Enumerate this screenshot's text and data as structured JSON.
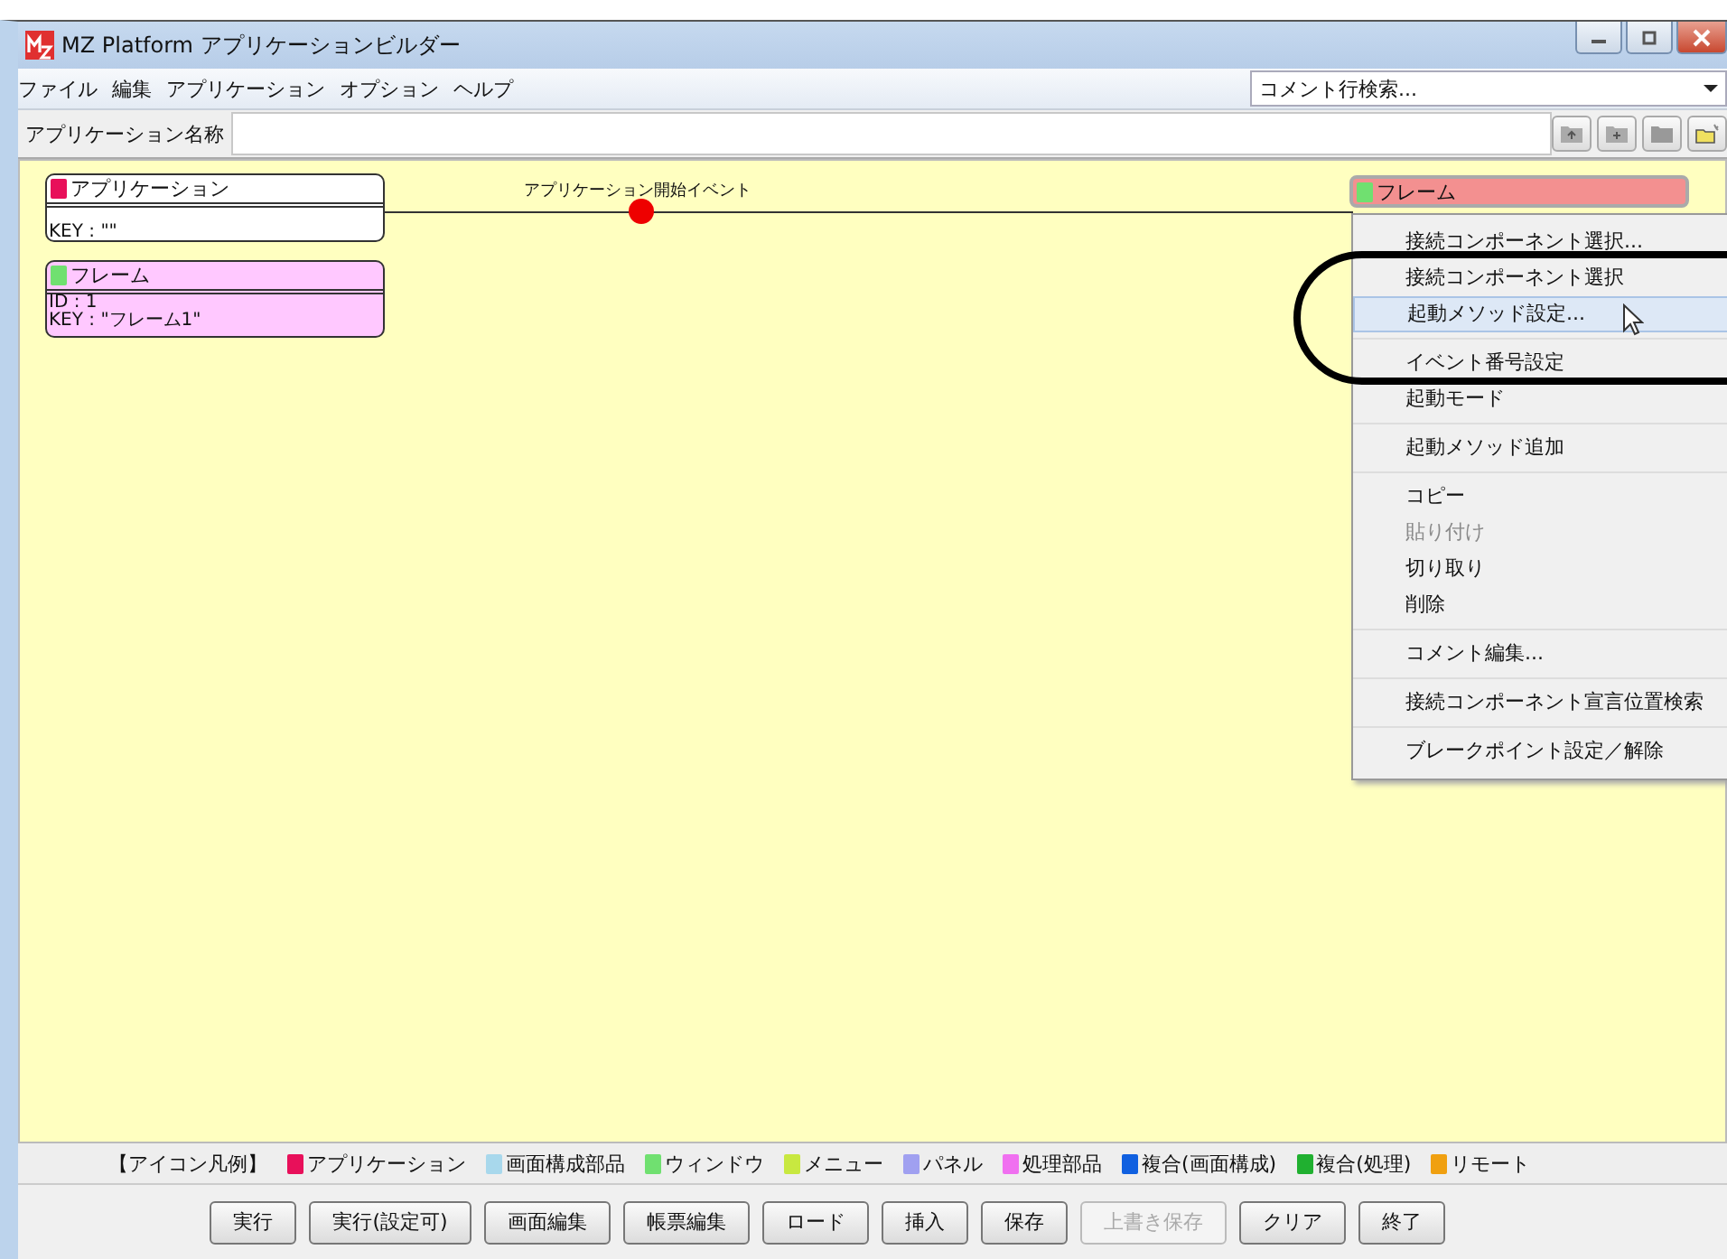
{
  "window": {
    "title": "MZ Platform アプリケーションビルダー"
  },
  "menubar": [
    "ファイル",
    "編集",
    "アプリケーション",
    "オプション",
    "ヘルプ"
  ],
  "comment_search": {
    "value": "コメント行検索..."
  },
  "app_name": {
    "label": "アプリケーション名称"
  },
  "nodes": [
    {
      "kind": "app",
      "title": "アプリケーション",
      "color": "#e8105a",
      "lines": [
        "KEY : \"\""
      ]
    },
    {
      "kind": "proc",
      "title": "フレーム",
      "color": "#70e070",
      "lines": [
        "ID : 1",
        "KEY : \"フレーム1\""
      ]
    }
  ],
  "event": {
    "label": "アプリケーション開始イベント"
  },
  "target_node": {
    "title": "フレーム",
    "color": "#70e070"
  },
  "context_menu": [
    [
      {
        "label": "接続コンポーネント選択...",
        "disabled": false,
        "selected": false
      },
      {
        "label": "接続コンポーネント選択",
        "disabled": false,
        "selected": false
      },
      {
        "label": "起動メソッド設定...",
        "disabled": false,
        "selected": true
      }
    ],
    [
      {
        "label": "イベント番号設定",
        "disabled": false,
        "selected": false
      },
      {
        "label": "起動モード",
        "disabled": false,
        "selected": false
      }
    ],
    [
      {
        "label": "起動メソッド追加",
        "disabled": false,
        "selected": false
      }
    ],
    [
      {
        "label": "コピー",
        "disabled": false,
        "selected": false
      },
      {
        "label": "貼り付け",
        "disabled": true,
        "selected": false
      },
      {
        "label": "切り取り",
        "disabled": false,
        "selected": false
      },
      {
        "label": "削除",
        "disabled": false,
        "selected": false
      }
    ],
    [
      {
        "label": "コメント編集...",
        "disabled": false,
        "selected": false
      }
    ],
    [
      {
        "label": "接続コンポーネント宣言位置検索",
        "disabled": false,
        "selected": false
      }
    ],
    [
      {
        "label": "ブレークポイント設定／解除",
        "disabled": false,
        "selected": false
      }
    ]
  ],
  "legend": {
    "title": "【アイコン凡例】",
    "items": [
      {
        "label": "アプリケーション",
        "color": "#e8105a"
      },
      {
        "label": "画面構成部品",
        "color": "#a8d8ec"
      },
      {
        "label": "ウィンドウ",
        "color": "#70e070"
      },
      {
        "label": "メニュー",
        "color": "#c8e840"
      },
      {
        "label": "パネル",
        "color": "#a0a0f0"
      },
      {
        "label": "処理部品",
        "color": "#f070f0"
      },
      {
        "label": "複合(画面構成)",
        "color": "#1060e0"
      },
      {
        "label": "複合(処理)",
        "color": "#20b030"
      },
      {
        "label": "リモート",
        "color": "#f0a010"
      }
    ]
  },
  "buttons": [
    {
      "label": "実行",
      "disabled": false
    },
    {
      "label": "実行(設定可)",
      "disabled": false
    },
    {
      "label": "画面編集",
      "disabled": false
    },
    {
      "label": "帳票編集",
      "disabled": false
    },
    {
      "label": "ロード",
      "disabled": false
    },
    {
      "label": "挿入",
      "disabled": false
    },
    {
      "label": "保存",
      "disabled": false
    },
    {
      "label": "上書き保存",
      "disabled": true
    },
    {
      "label": "クリア",
      "disabled": false
    },
    {
      "label": "終了",
      "disabled": false
    }
  ]
}
